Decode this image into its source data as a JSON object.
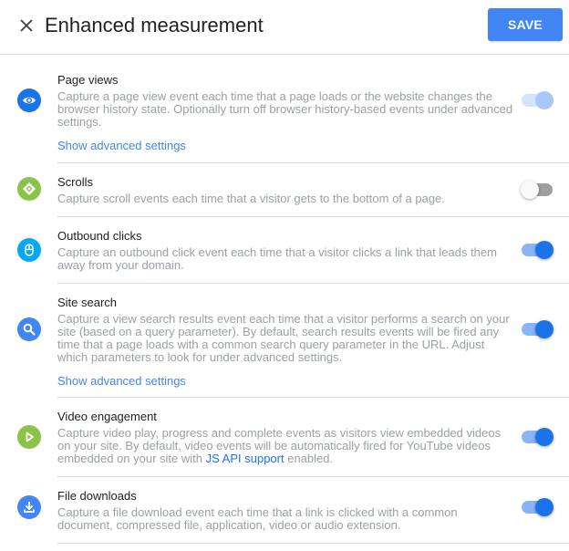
{
  "header": {
    "title": "Enhanced measurement",
    "close_icon": "close-icon",
    "save_label": "SAVE"
  },
  "colors": {
    "accent": "#4285f4",
    "toggle_on": "#1a73e8",
    "link": "#1a73e8",
    "green_icon": "#8bc34a",
    "cyan_icon": "#03a9f4",
    "blue_icon": "#4285f4"
  },
  "items": [
    {
      "name": "Page views",
      "icon": "eye-icon",
      "description": "Capture a page view event each time that a page loads or the website changes the browser history state. Optionally turn off browser history-based events under advanced settings.",
      "advanced_link": "Show advanced settings",
      "enabled": true,
      "toggle_disabled": true
    },
    {
      "name": "Scrolls",
      "icon": "scroll-icon",
      "description": "Capture scroll events each time that a visitor gets to the bottom of a page.",
      "enabled": false
    },
    {
      "name": "Outbound clicks",
      "icon": "mouse-icon",
      "description": "Capture an outbound click event each time that a visitor clicks a link that leads them away from your domain.",
      "enabled": true
    },
    {
      "name": "Site search",
      "icon": "search-icon",
      "description": "Capture a view search results event each time that a visitor performs a search on your site (based on a query parameter). By default, search results events will be fired any time that a page loads with a common search query parameter in the URL. Adjust which parameters to look for under advanced settings.",
      "advanced_link": "Show advanced settings",
      "enabled": true
    },
    {
      "name": "Video engagement",
      "icon": "play-icon",
      "description_before": "Capture video play, progress and complete events as visitors view embedded videos on your site. By default, video events will be automatically fired for YouTube videos embedded on your site with ",
      "description_link": "JS API support",
      "description_after": " enabled.",
      "enabled": true
    },
    {
      "name": "File downloads",
      "icon": "download-icon",
      "description": "Capture a file download event each time that a link is clicked with a common document, compressed file, application, video or audio extension.",
      "enabled": true
    }
  ]
}
